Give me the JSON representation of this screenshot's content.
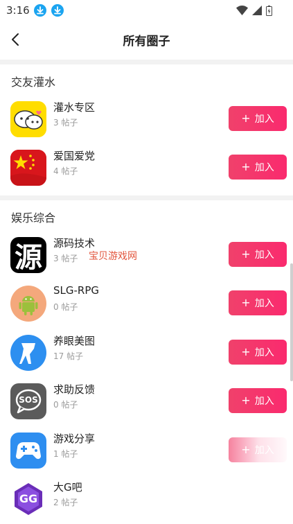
{
  "status_bar": {
    "time": "3:16"
  },
  "header": {
    "title": "所有圈子"
  },
  "watermark": "宝贝游戏网",
  "join_label": "加入",
  "sections": [
    {
      "title": "交友灌水",
      "items": [
        {
          "name": "灌水专区",
          "count": "3 帖子"
        },
        {
          "name": "爱国爱党",
          "count": "4 帖子"
        }
      ]
    },
    {
      "title": "娱乐综合",
      "items": [
        {
          "name": "源码技术",
          "count": "3 帖子",
          "icon_text": "源"
        },
        {
          "name": "SLG-RPG",
          "count": "0 帖子"
        },
        {
          "name": "养眼美图",
          "count": "17 帖子"
        },
        {
          "name": "求助反馈",
          "count": "0 帖子",
          "icon_text": "SOS"
        },
        {
          "name": "游戏分享",
          "count": "1 帖子"
        },
        {
          "name": "大G吧",
          "count": "2 帖子",
          "icon_text": "GG"
        }
      ]
    }
  ],
  "colors": {
    "accent": "#f0416b",
    "download_icon": "#1ba4f0"
  }
}
